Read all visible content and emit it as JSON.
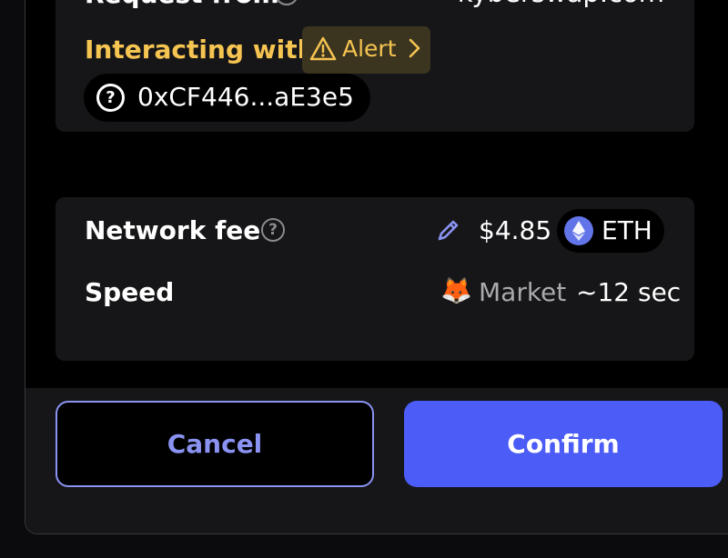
{
  "request": {
    "label": "Request from",
    "origin": "kyberswap.com"
  },
  "interaction": {
    "label": "Interacting with",
    "alert_label": "Alert",
    "address": "0xCF446...aE3e5"
  },
  "fee": {
    "label": "Network fee",
    "amount": "$4.85",
    "token": "ETH"
  },
  "speed": {
    "label": "Speed",
    "emoji": "🦊",
    "mode": "Market",
    "estimate": "~12 sec"
  },
  "actions": {
    "cancel_label": "Cancel",
    "confirm_label": "Confirm"
  },
  "icons": {
    "help": "question-circle-icon",
    "warning": "warning-triangle-icon",
    "chevron": "chevron-right-icon",
    "edit": "pencil-icon",
    "token": "ethereum-icon"
  },
  "colors": {
    "accent": "#4c5cf6",
    "accent_light": "#8b93f2",
    "warning": "#f5c451",
    "card": "#161618"
  }
}
